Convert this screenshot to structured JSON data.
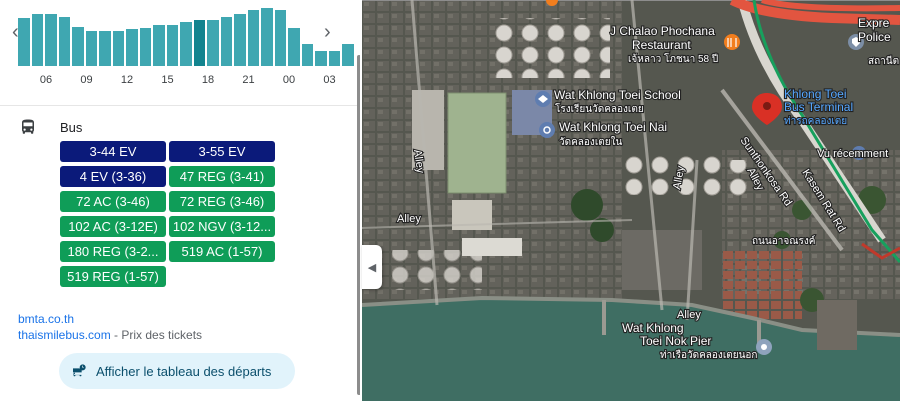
{
  "histogram": {
    "hour_labels": [
      "06",
      "09",
      "12",
      "15",
      "18",
      "21",
      "00",
      "03"
    ],
    "bar_levels": [
      0.82,
      0.9,
      0.9,
      0.85,
      0.68,
      0.6,
      0.6,
      0.6,
      0.63,
      0.65,
      0.7,
      0.7,
      0.76,
      0.8,
      0.8,
      0.85,
      0.9,
      0.97,
      1.0,
      0.97,
      0.65,
      0.38,
      0.25,
      0.25,
      0.38
    ],
    "current_bar_index": 13,
    "colors": {
      "bar": "#3fa7b1",
      "current": "#12848f"
    }
  },
  "transit": {
    "mode_icon": "bus-icon",
    "mode_label": "Bus",
    "routes": [
      {
        "label": "3-44 EV",
        "color": "#0b1a7a"
      },
      {
        "label": "3-55 EV",
        "color": "#0b1a7a"
      },
      {
        "label": "4 EV (3-36)",
        "color": "#0b1a7a"
      },
      {
        "label": "47 REG (3-41)",
        "color": "#0f9d58"
      },
      {
        "label": "72 AC (3-46)",
        "color": "#0f9d58"
      },
      {
        "label": "72 REG (3-46)",
        "color": "#0f9d58"
      },
      {
        "label": "102 AC (3-12E)",
        "color": "#0f9d58"
      },
      {
        "label": "102 NGV (3-12...",
        "color": "#0f9d58"
      },
      {
        "label": "180 REG (3-2...",
        "color": "#0f9d58"
      },
      {
        "label": "519 AC (1-57)",
        "color": "#0f9d58"
      },
      {
        "label": "519 REG (1-57)",
        "color": "#0f9d58"
      }
    ]
  },
  "links": {
    "bmta": "bmta.co.th",
    "thaismile": "thaismilebus.com",
    "thaismile_suffix": " - Prix des tickets"
  },
  "departures_button": {
    "icon": "bus-schedule-icon",
    "label": "Afficher le tableau des départs"
  },
  "map": {
    "labels": {
      "chalao_line1": "J Chalao Phochana",
      "chalao_line2": "Restaurant",
      "chalao_thai": "เจ้หลาว โภชนา 58 ปี",
      "terminal_line1": "Khlong Toei",
      "terminal_line2": "Bus Terminal",
      "terminal_thai": "ท่ารถคลองเตย",
      "express_line1": "Expre",
      "express_line2": "Police",
      "express_thai": "สถานีต",
      "school_line1": "Wat Khlong Toei School",
      "school_thai": "โรงเรียนวัดคลองเตย",
      "temple_line1": "Wat Khlong Toei Nai",
      "temple_thai": "วัดคลองเตยใน",
      "recent": "Vu récemment",
      "sunthonkosa": "Sunthonkosa Rd",
      "kasem": "Kasem Rat Rd",
      "alley": "Alley",
      "thai_road": "ถนนอาจณรงค์",
      "pier_line1": "Wat Khlong",
      "pier_line2": "Toei Nok Pier",
      "pier_thai": "ท่าเรือวัดคลองเตยนอก"
    },
    "colors": {
      "water": "#3f6e63",
      "road": "#e25540",
      "transit_line": "#17a05d",
      "pin": "#d93025"
    }
  }
}
